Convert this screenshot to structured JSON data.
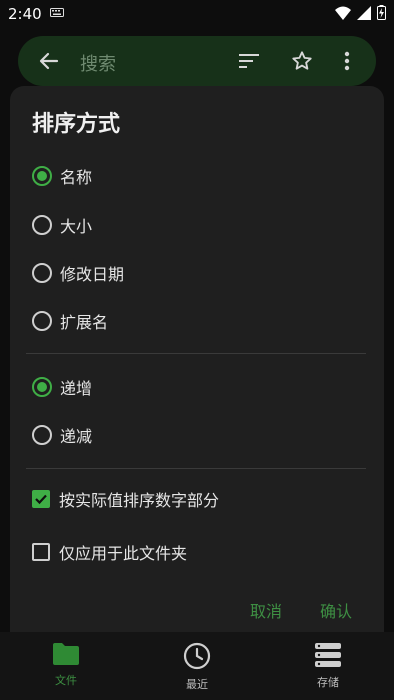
{
  "status_bar": {
    "time": "2:40"
  },
  "search": {
    "placeholder": "搜索"
  },
  "dialog": {
    "title": "排序方式",
    "sort_by": [
      {
        "label": "名称",
        "selected": true
      },
      {
        "label": "大小",
        "selected": false
      },
      {
        "label": "修改日期",
        "selected": false
      },
      {
        "label": "扩展名",
        "selected": false
      }
    ],
    "order": [
      {
        "label": "递增",
        "selected": true
      },
      {
        "label": "递减",
        "selected": false
      }
    ],
    "options": [
      {
        "label": "按实际值排序数字部分",
        "checked": true
      },
      {
        "label": "仅应用于此文件夹",
        "checked": false
      }
    ],
    "cancel_label": "取消",
    "confirm_label": "确认"
  },
  "bottom_nav": [
    {
      "label": "文件",
      "icon": "folder-icon",
      "active": true
    },
    {
      "label": "最近",
      "icon": "clock-icon",
      "active": false
    },
    {
      "label": "存储",
      "icon": "storage-icon",
      "active": false
    }
  ],
  "colors": {
    "accent": "#3fae46",
    "dialog_bg": "#1f1f1f",
    "searchbar_bg": "#173119"
  }
}
